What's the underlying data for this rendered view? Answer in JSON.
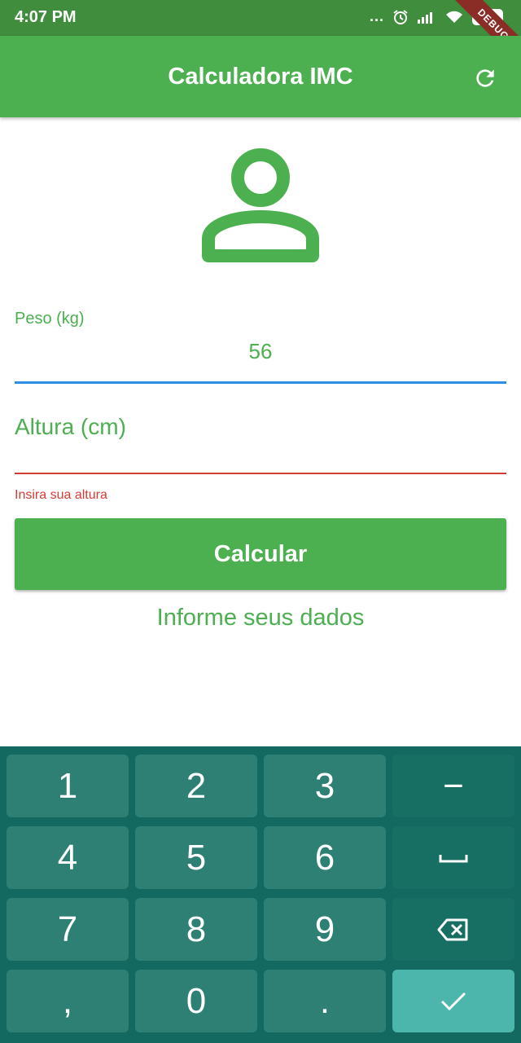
{
  "status_bar": {
    "time": "4:07 PM",
    "dots": "...",
    "battery": "51",
    "debug_banner": "DEBUG"
  },
  "app_bar": {
    "title": "Calculadora IMC",
    "refresh_icon": "refresh-icon"
  },
  "form": {
    "avatar_icon": "person-outline-icon",
    "peso": {
      "label": "Peso (kg)",
      "value": "56"
    },
    "altura": {
      "label": "Altura (cm)",
      "value": "",
      "error": "Insira sua altura"
    },
    "calculate_button": "Calcular",
    "info_text": "Informe seus dados"
  },
  "keyboard": {
    "row1": [
      "1",
      "2",
      "3",
      "−"
    ],
    "row2": [
      "4",
      "5",
      "6",
      "␣"
    ],
    "row3": [
      "7",
      "8",
      "9",
      "backspace"
    ],
    "row4": [
      ",",
      "0",
      ".",
      "done"
    ]
  },
  "colors": {
    "primary": "#4caf50",
    "status_bar": "#3f8d3d",
    "error": "#d33d33",
    "focus_underline": "#2f8fe6",
    "keyboard_bg": "#13695f",
    "key_bg": "#2e8075",
    "key_done": "#4db6ac"
  }
}
